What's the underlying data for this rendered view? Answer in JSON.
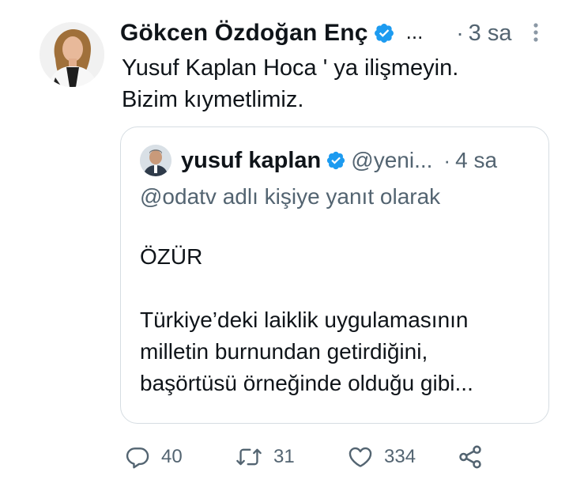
{
  "tweet": {
    "author_name": "Gökcen Özdoğan Enç",
    "handle_ellipsis": "...",
    "separator": "·",
    "time": "3 sa",
    "text_lines": [
      "Yusuf Kaplan Hoca ' ya ilişmeyin.",
      "Bizim kıymetlimiz."
    ]
  },
  "quoted_tweet": {
    "author_name": "yusuf kaplan",
    "handle": "@yeni...",
    "separator": "·",
    "time": "4 sa",
    "reply_context": "@odatv adlı kişiye yanıt olarak",
    "body_lines": [
      "ÖZÜR",
      "",
      "Türkiye’deki laiklik uygulamasının",
      "milletin burnundan getirdiğini,",
      "başörtüsü örneğinde olduğu gibi..."
    ]
  },
  "actions": {
    "reply_count": "40",
    "retweet_count": "31",
    "like_count": "334"
  },
  "colors": {
    "text": "#0f1419",
    "secondary": "#536471",
    "verified": "#1d9bf0",
    "border": "#d6dde2"
  },
  "icons": [
    "verified-badge-icon",
    "more-options-icon",
    "reply-icon",
    "retweet-icon",
    "like-icon",
    "share-icon"
  ]
}
